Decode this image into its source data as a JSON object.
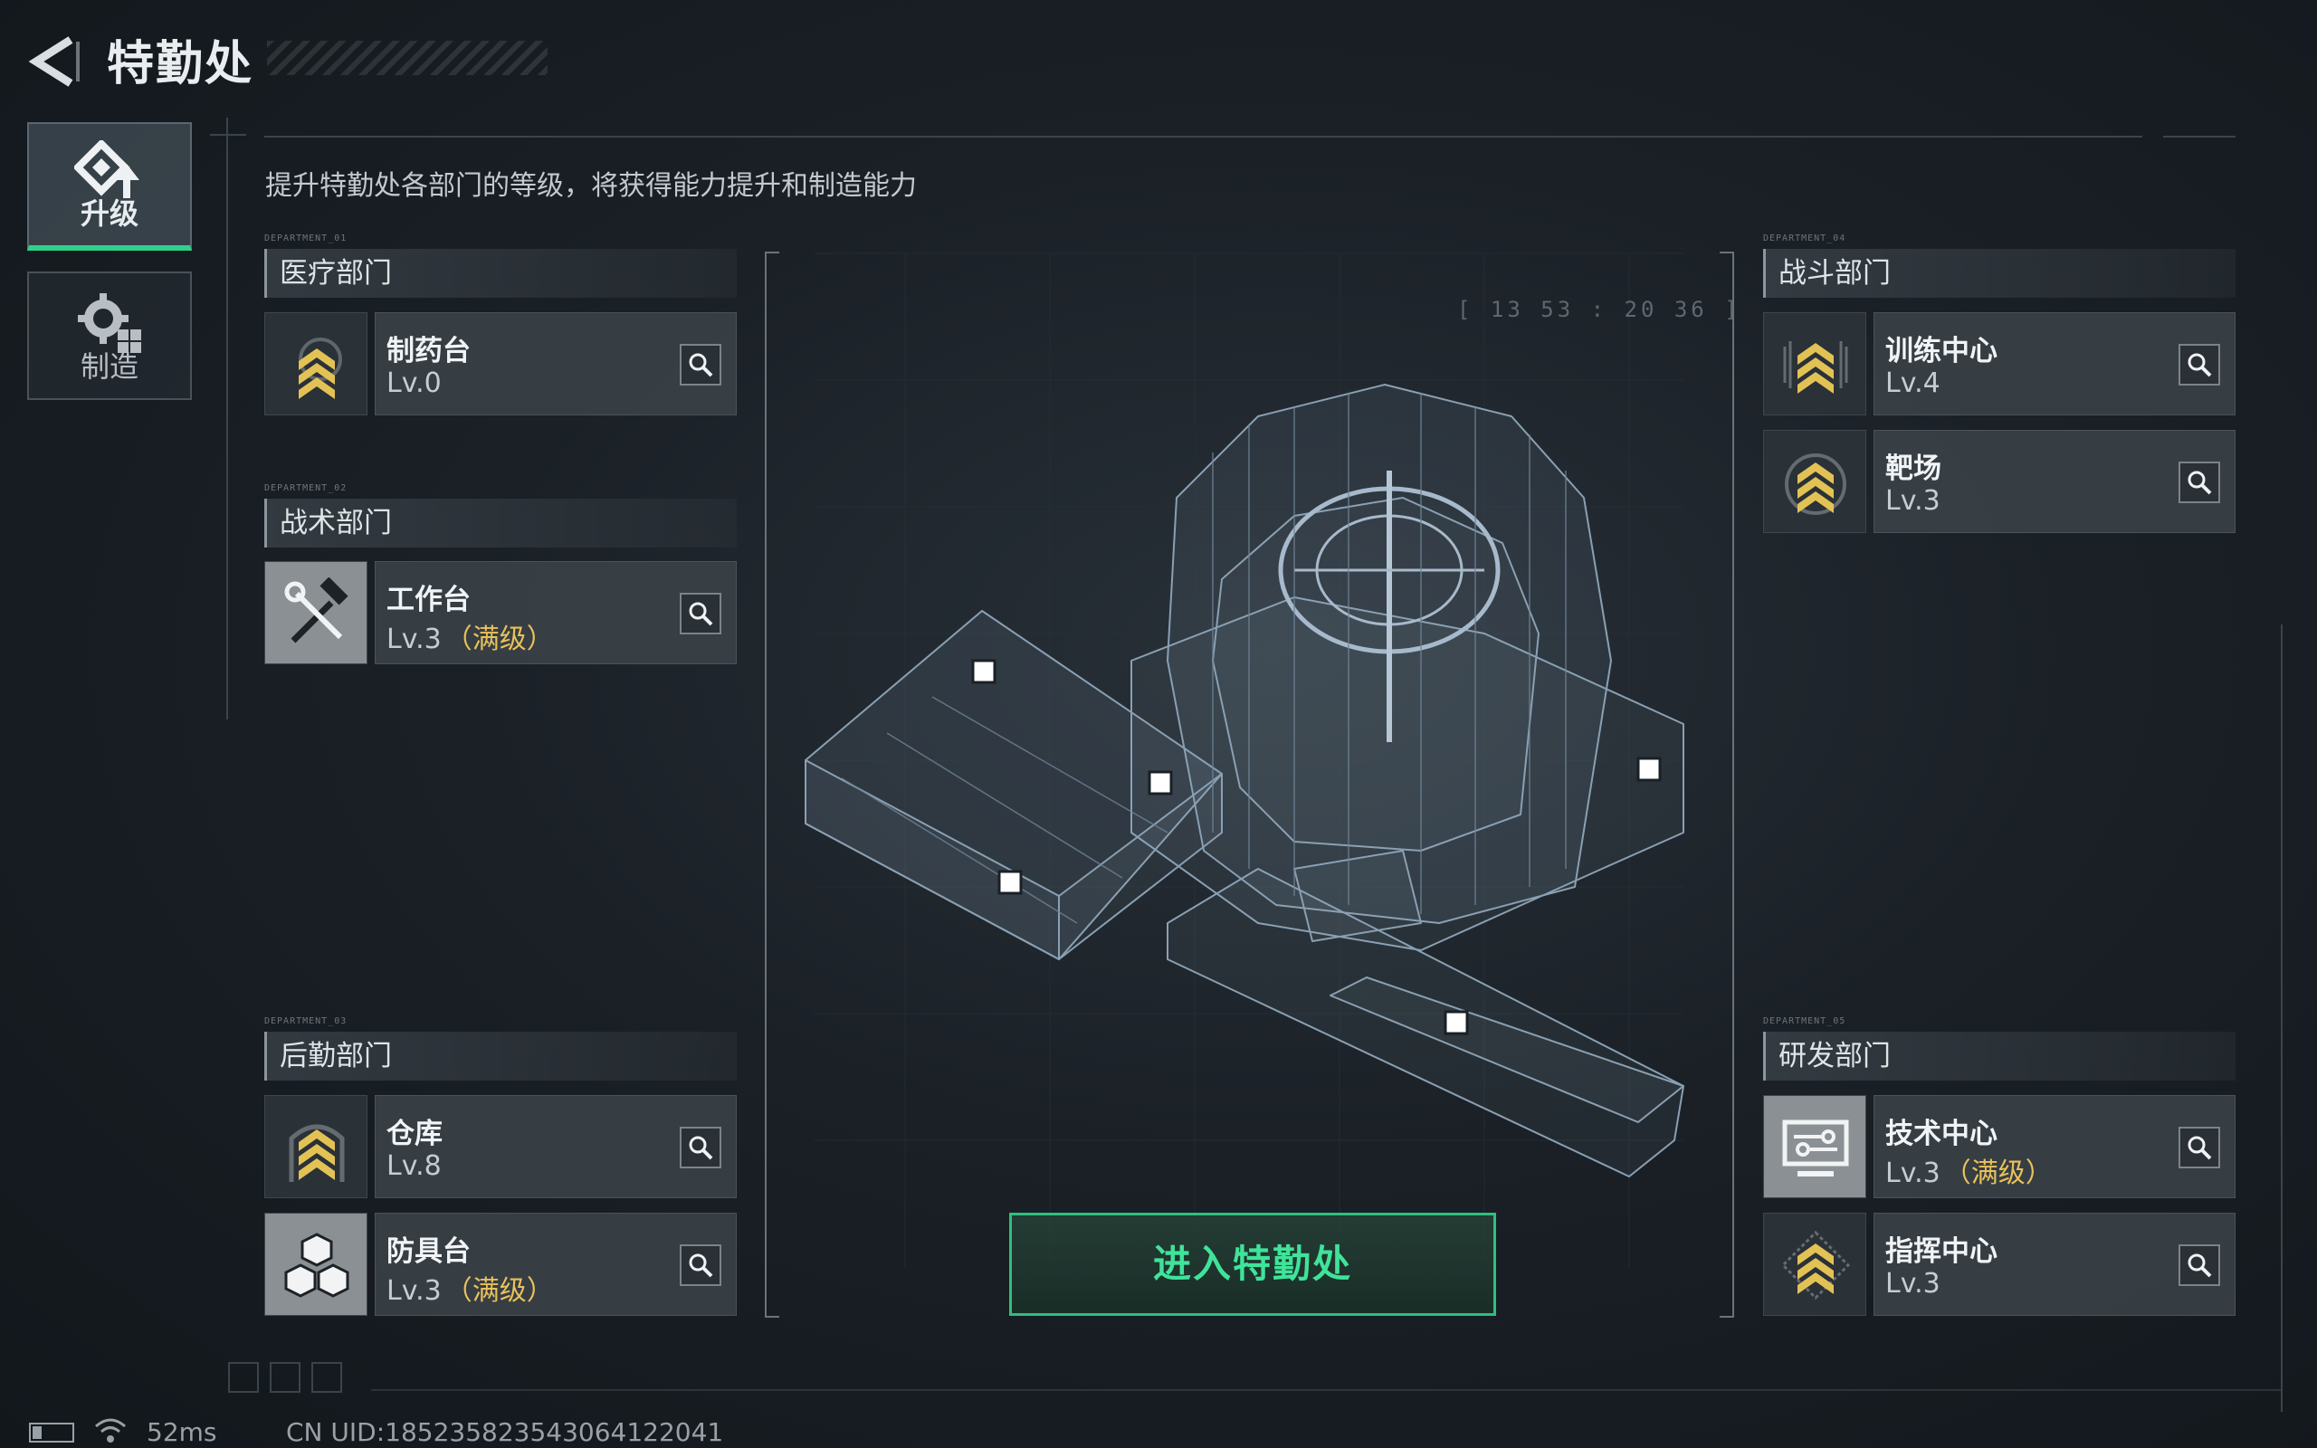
{
  "header": {
    "title": "特勤处"
  },
  "tabs": [
    {
      "label": "升级",
      "icon": "upgrade-icon",
      "active": true
    },
    {
      "label": "制造",
      "icon": "gear-craft-icon",
      "active": false
    }
  ],
  "subtitle": "提升特勤处各部门的等级，将获得能力提升和制造能力",
  "departments": {
    "medical": {
      "tag": "DEPARTMENT_01",
      "title": "医疗部门",
      "facilities": [
        {
          "name": "制药台",
          "level": "Lv.0",
          "max": ""
        }
      ]
    },
    "tactical": {
      "tag": "DEPARTMENT_02",
      "title": "战术部门",
      "facilities": [
        {
          "name": "工作台",
          "level": "Lv.3",
          "max": "（满级）"
        }
      ]
    },
    "logistics": {
      "tag": "DEPARTMENT_03",
      "title": "后勤部门",
      "facilities": [
        {
          "name": "仓库",
          "level": "Lv.8",
          "max": ""
        },
        {
          "name": "防具台",
          "level": "Lv.3",
          "max": "（满级）"
        }
      ]
    },
    "combat": {
      "tag": "DEPARTMENT_04",
      "title": "战斗部门",
      "facilities": [
        {
          "name": "训练中心",
          "level": "Lv.4",
          "max": ""
        },
        {
          "name": "靶场",
          "level": "Lv.3",
          "max": ""
        }
      ]
    },
    "research": {
      "tag": "DEPARTMENT_05",
      "title": "研发部门",
      "facilities": [
        {
          "name": "技术中心",
          "level": "Lv.3",
          "max": "（满级）"
        },
        {
          "name": "指挥中心",
          "level": "Lv.3",
          "max": ""
        }
      ]
    }
  },
  "center": {
    "hud_time": "[ 13 53  :  20 36 ]",
    "enter_button": "进入特勤处"
  },
  "footer": {
    "ping": "52ms",
    "uid": "CN UID:18523582354306412204​1"
  },
  "colors": {
    "accent_green": "#2fd18a",
    "max_level_gold": "#e8c15a",
    "chevron_gold": "#e3c255"
  }
}
